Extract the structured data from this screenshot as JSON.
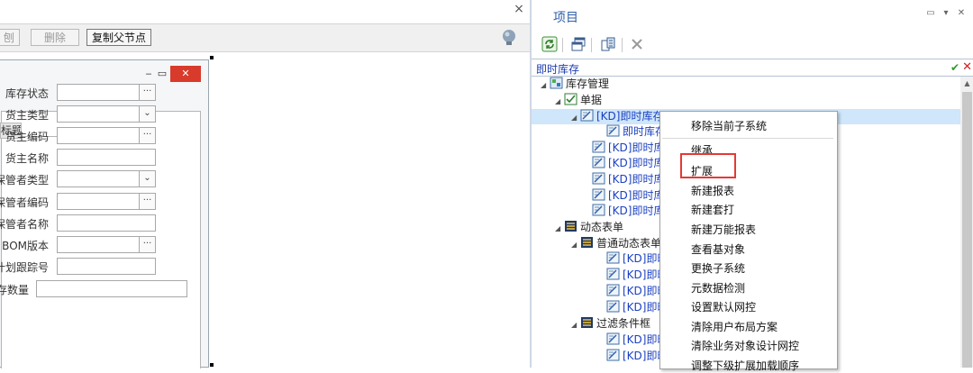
{
  "left": {
    "close_glyph": "×",
    "toolbar": {
      "btn_partial": "刨",
      "delete_label": "删除",
      "copy_parent_label": "复制父节点"
    },
    "form": {
      "minimize": "‒",
      "maximize": "▭",
      "close": "✕",
      "group_title": "标题",
      "fields": [
        {
          "label": "库存状态",
          "kind": "lookup"
        },
        {
          "label": "货主类型",
          "kind": "combo"
        },
        {
          "label": "货主编码",
          "kind": "lookup"
        },
        {
          "label": "货主名称",
          "kind": "text"
        },
        {
          "label": "保管者类型",
          "kind": "combo"
        },
        {
          "label": "保管者编码",
          "kind": "lookup"
        },
        {
          "label": "保管者名称",
          "kind": "text"
        },
        {
          "label": "BOM版本",
          "kind": "lookup"
        },
        {
          "label": "计划跟踪号",
          "kind": "text"
        },
        {
          "label": "库存数量",
          "kind": "wide"
        }
      ],
      "lookup_glyph": "···",
      "combo_glyph": "⌄"
    }
  },
  "project": {
    "title": "项目",
    "controls": [
      "▭",
      "▾",
      "✕"
    ],
    "search_value": "即时库存",
    "search_ok": "✔",
    "search_cancel": "✕",
    "tree": [
      {
        "label": "库存管理",
        "style": "normal"
      },
      {
        "label": "单据",
        "style": "normal"
      },
      {
        "label": "[KD]即时库存",
        "style": "link"
      },
      {
        "label": "即时库存",
        "style": "link"
      },
      {
        "label": "[KD]即时库存",
        "style": "link"
      },
      {
        "label": "[KD]即时库存",
        "style": "link"
      },
      {
        "label": "[KD]即时库存",
        "style": "link"
      },
      {
        "label": "[KD]即时库存",
        "style": "link"
      },
      {
        "label": "[KD]即时库存",
        "style": "link"
      },
      {
        "label": "动态表单",
        "style": "normal"
      },
      {
        "label": "普通动态表单",
        "style": "normal"
      },
      {
        "label": "[KD]即时",
        "style": "link"
      },
      {
        "label": "[KD]即时",
        "style": "link"
      },
      {
        "label": "[KD]即时",
        "style": "link"
      },
      {
        "label": "[KD]即时",
        "style": "link"
      },
      {
        "label": "过滤条件框",
        "style": "normal"
      },
      {
        "label": "[KD]即时",
        "style": "link"
      },
      {
        "label": "[KD]即时",
        "style": "link"
      }
    ]
  },
  "context_menu": {
    "items": [
      "移除当前子系统",
      "继承",
      "扩展",
      "新建报表",
      "新建套打",
      "新建万能报表",
      "查看基对象",
      "更换子系统",
      "元数据检测",
      "设置默认网控",
      "清除用户布局方案",
      "清除业务对象设计网控",
      "调整下级扩展加载顺序"
    ],
    "highlighted": "扩展",
    "highlight_color": "#e53935"
  }
}
